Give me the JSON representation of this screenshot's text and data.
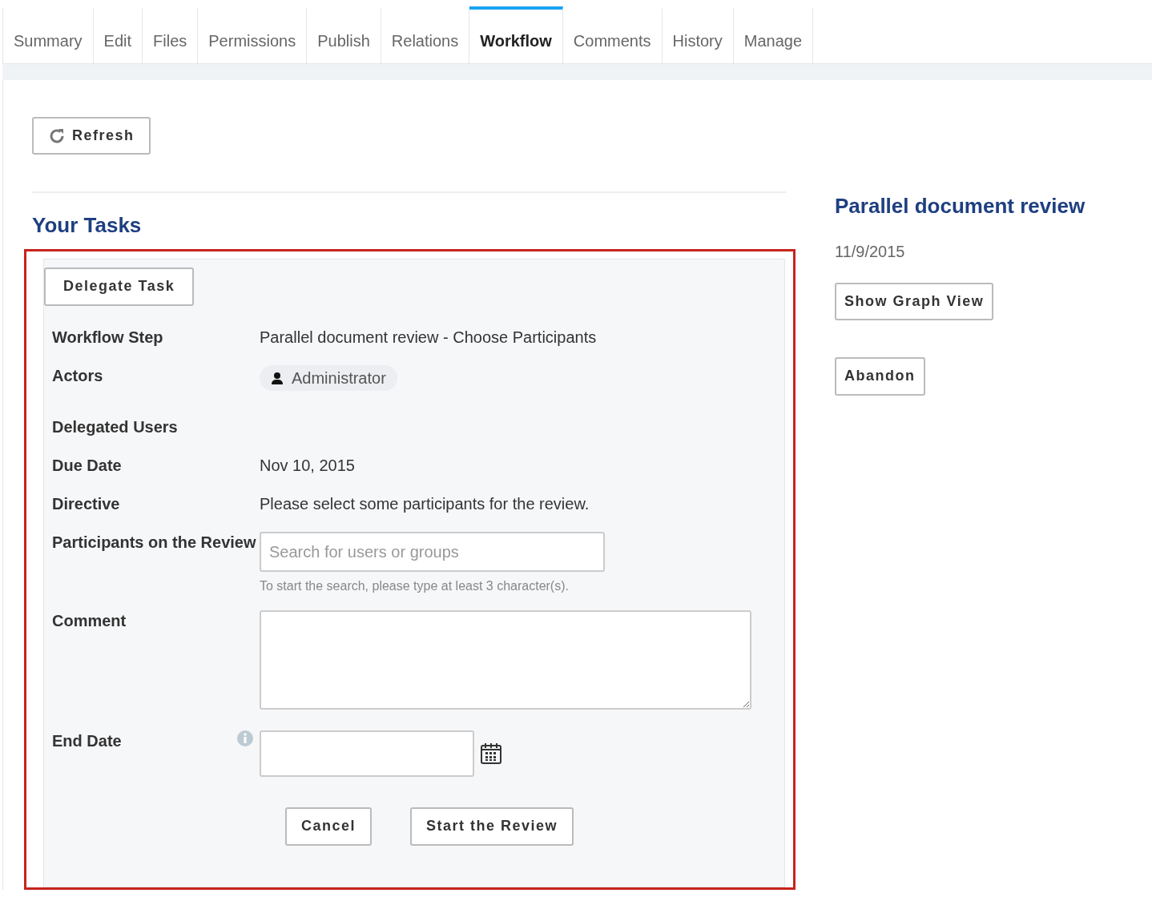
{
  "tabs": [
    {
      "label": "Summary",
      "selected": false
    },
    {
      "label": "Edit",
      "selected": false
    },
    {
      "label": "Files",
      "selected": false
    },
    {
      "label": "Permissions",
      "selected": false
    },
    {
      "label": "Publish",
      "selected": false
    },
    {
      "label": "Relations",
      "selected": false
    },
    {
      "label": "Workflow",
      "selected": true
    },
    {
      "label": "Comments",
      "selected": false
    },
    {
      "label": "History",
      "selected": false
    },
    {
      "label": "Manage",
      "selected": false
    }
  ],
  "refresh_button": "Refresh",
  "tasks": {
    "title": "Your Tasks",
    "delegate_button": "Delegate Task",
    "fields": [
      {
        "kind": "text",
        "label": "Workflow Step",
        "value": "Parallel document review - Choose Participants"
      },
      {
        "kind": "actor",
        "label": "Actors",
        "value": "Administrator"
      },
      {
        "kind": "empty",
        "label": "Delegated Users"
      },
      {
        "kind": "text",
        "label": "Due Date",
        "value": "Nov 10, 2015"
      },
      {
        "kind": "text",
        "label": "Directive",
        "value": "Please select some participants for the review."
      },
      {
        "kind": "search",
        "label": "Participants on the Review",
        "placeholder": "Search for users or groups",
        "help": "To start the search, please type at least 3 character(s)."
      },
      {
        "kind": "textarea",
        "label": "Comment"
      },
      {
        "kind": "date",
        "label": "End Date"
      }
    ],
    "buttons": [
      "Cancel",
      "Start the Review"
    ]
  },
  "workflow": {
    "title": "Parallel document review",
    "date": "11/9/2015",
    "buttons": [
      "Show Graph View",
      "Abandon"
    ]
  }
}
